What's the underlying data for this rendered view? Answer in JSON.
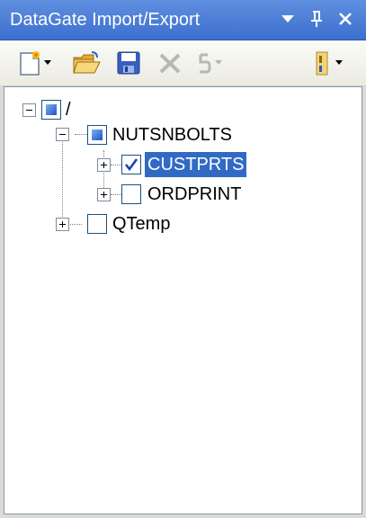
{
  "window": {
    "title": "DataGate Import/Export",
    "buttons": {
      "dropdown": "chevron-down-icon",
      "pin": "pin-icon",
      "close": "close-icon"
    }
  },
  "toolbar": {
    "items": [
      {
        "name": "new-icon",
        "has_dropdown": true
      },
      {
        "name": "open-folder-icon",
        "has_dropdown": false
      },
      {
        "name": "save-icon",
        "has_dropdown": false
      },
      {
        "name": "delete-icon",
        "has_dropdown": false,
        "disabled": true
      },
      {
        "name": "undo-icon",
        "has_dropdown": true,
        "disabled": true
      },
      {
        "name": "options-icon",
        "has_dropdown": true
      }
    ]
  },
  "tree": {
    "root": {
      "label": "/",
      "expanded": true,
      "check": "indeterminate"
    },
    "nutsnbolts": {
      "label": "NUTSNBOLTS",
      "expanded": true,
      "check": "indeterminate"
    },
    "custprts": {
      "label": "CUSTPRTS",
      "expanded": false,
      "check": "checked",
      "selected": true
    },
    "ordprint": {
      "label": "ORDPRINT",
      "expanded": false,
      "check": "unchecked"
    },
    "qtemp": {
      "label": "QTemp",
      "expanded": false,
      "check": "unchecked"
    }
  },
  "colors": {
    "titlebar": "#3d6fce",
    "selection": "#316ac5",
    "panel": "#dcdcd2",
    "checkmark": "#1d3fb0"
  }
}
